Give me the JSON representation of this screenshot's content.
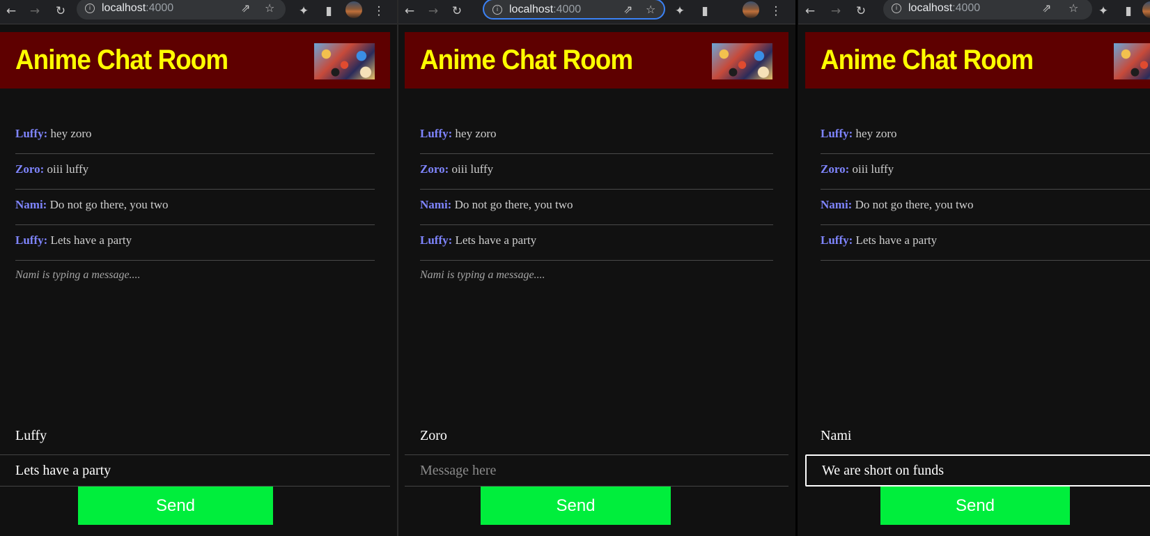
{
  "browser": {
    "host": "localhost",
    "port": ":4000",
    "icons": {
      "back": "←",
      "forward": "→",
      "reload": "↻",
      "info": "i",
      "share": "⇗",
      "star": "☆",
      "extensions": "✦",
      "sidepanel": "▮",
      "menu": "⋮"
    }
  },
  "app": {
    "title": "Anime Chat Room",
    "colors": {
      "header_bg": "#5e0000",
      "title": "#ffff00",
      "sender": "#7f85ff",
      "send_bg": "#00ee3c"
    }
  },
  "windows": [
    {
      "messages": [
        {
          "sender": "Luffy:",
          "text": "hey zoro"
        },
        {
          "sender": "Zoro:",
          "text": "oiii luffy"
        },
        {
          "sender": "Nami:",
          "text": "Do not go there, you two"
        },
        {
          "sender": "Luffy:",
          "text": "Lets have a party"
        }
      ],
      "typing": "Nami is typing a message....",
      "username": "Luffy",
      "input_value": "Lets have a party",
      "input_placeholder": "Message here",
      "send_label": "Send"
    },
    {
      "messages": [
        {
          "sender": "Luffy:",
          "text": "hey zoro"
        },
        {
          "sender": "Zoro:",
          "text": "oiii luffy"
        },
        {
          "sender": "Nami:",
          "text": "Do not go there, you two"
        },
        {
          "sender": "Luffy:",
          "text": "Lets have a party"
        }
      ],
      "typing": "Nami is typing a message....",
      "username": "Zoro",
      "input_value": "",
      "input_placeholder": "Message here",
      "send_label": "Send"
    },
    {
      "messages": [
        {
          "sender": "Luffy:",
          "text": "hey zoro"
        },
        {
          "sender": "Zoro:",
          "text": "oiii luffy"
        },
        {
          "sender": "Nami:",
          "text": "Do not go there, you two"
        },
        {
          "sender": "Luffy:",
          "text": "Lets have a party"
        }
      ],
      "typing": "",
      "username": "Nami",
      "input_value": "We are short on funds",
      "input_placeholder": "Message here",
      "send_label": "Send"
    }
  ]
}
